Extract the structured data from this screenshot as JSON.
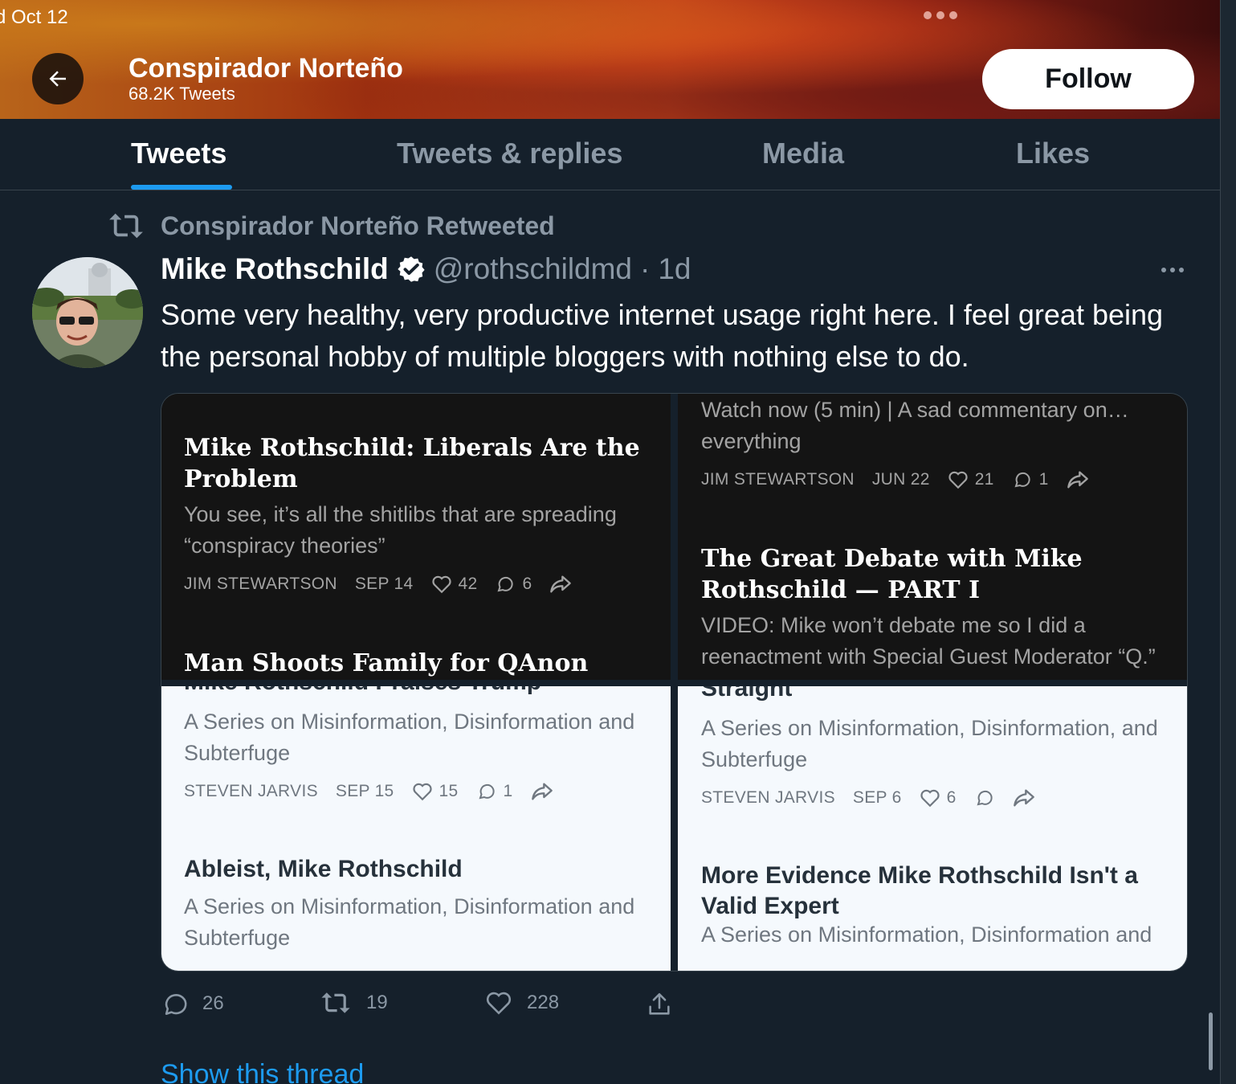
{
  "status": {
    "time": "d Oct 12"
  },
  "header": {
    "title": "Conspirador Norteño",
    "subtitle": "68.2K Tweets",
    "follow_label": "Follow"
  },
  "tabs": [
    {
      "label": "Tweets",
      "active": true
    },
    {
      "label": "Tweets & replies",
      "active": false
    },
    {
      "label": "Media",
      "active": false
    },
    {
      "label": "Likes",
      "active": false
    }
  ],
  "tweet": {
    "retweet_label": "Conspirador Norteño Retweeted",
    "author_name": "Mike Rothschild",
    "handle": "@rothschildmd",
    "sep": "·",
    "time": "1d",
    "text": "Some very healthy, very productive internet usage right here. I feel great being the personal hobby of multiple bloggers with nothing else to do.",
    "actions": {
      "replies": "26",
      "retweets": "19",
      "likes": "228"
    },
    "show_thread": "Show this thread"
  },
  "media": {
    "top_left": {
      "title": "Mike Rothschild: Liberals Are the Problem",
      "subtitle": "You see, it’s all the shitlibs that are spreading “conspiracy theories”",
      "author": "JIM STEWARTSON",
      "date": "SEP 14",
      "likes": "42",
      "comments": "6",
      "next_title": "Man Shoots Family for QAnon"
    },
    "top_right": {
      "subtitle": "Watch now (5 min) | A sad commentary on… everything",
      "author": "JIM STEWARTSON",
      "date": "JUN 22",
      "likes": "21",
      "comments": "1",
      "title2": "The Great Debate with Mike Rothschild — PART I",
      "subtitle2": "VIDEO: Mike won’t debate me so I did a reenactment with Special Guest Moderator “Q.”"
    },
    "bottom_left": {
      "cut_title": "Mike Rothschild Praises Trump",
      "subtitle": "A Series on Misinformation, Disinformation and Subterfuge",
      "author": "STEVEN JARVIS",
      "date": "SEP 15",
      "likes": "15",
      "comments": "1",
      "title2": "Ableist, Mike Rothschild",
      "subtitle2": "A Series on Misinformation, Disinformation and Subterfuge"
    },
    "bottom_right": {
      "cut_title": "Straight",
      "subtitle": "A Series on Misinformation, Disinformation, and Subterfuge",
      "author": "STEVEN JARVIS",
      "date": "SEP 6",
      "likes": "6",
      "title2": "More Evidence Mike Rothschild Isn't a Valid Expert",
      "subtitle2": "A Series on Misinformation, Disinformation and"
    }
  },
  "colors": {
    "background": "#15202b",
    "accent": "#1d9bf0",
    "muted": "#8b98a5"
  }
}
